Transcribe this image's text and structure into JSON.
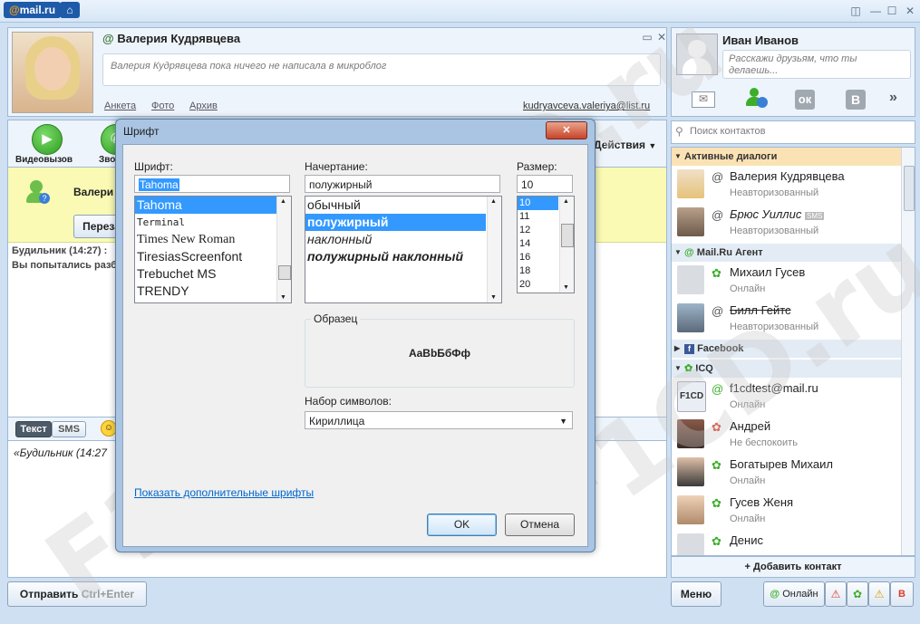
{
  "app": {
    "logo": "mail.ru",
    "logo_at": "@"
  },
  "profile": {
    "name": "Валерия Кудрявцева",
    "microblog": "Валерия Кудрявцева пока ничего не написала в микроблог",
    "links": [
      "Анкета",
      "Фото",
      "Архив"
    ],
    "email": "kudryavceva.valeriya@list.ru"
  },
  "toolbar": {
    "video_call": "Видеовызов",
    "call": "Зво",
    "actions": "Действия"
  },
  "chat": {
    "banner_name": "Валери",
    "resend": "Переза",
    "log_line1": "Будильник (14:27) :",
    "log_line2": "Вы попытались разб",
    "tab_text": "Текст",
    "tab_sms": "SMS",
    "input_text": "«Будильник (14:27"
  },
  "send": {
    "label": "Отправить",
    "shortcut": "Ctrl+Enter"
  },
  "dialog": {
    "title": "Шрифт",
    "font_label": "Шрифт:",
    "font_value": "Tahoma",
    "fonts": [
      "Tahoma",
      "Terminal",
      "Times New Roman",
      "TiresiasScreenfont",
      "Trebuchet MS",
      "TRENDY"
    ],
    "style_label": "Начертание:",
    "style_value": "полужирный",
    "styles": [
      "обычный",
      "полужирный",
      "наклонный",
      "полужирный наклонный"
    ],
    "size_label": "Размер:",
    "size_value": "10",
    "sizes": [
      "10",
      "11",
      "12",
      "14",
      "16",
      "18",
      "20"
    ],
    "sample_label": "Образец",
    "sample_text": "AaBbБбФф",
    "charset_label": "Набор символов:",
    "charset_value": "Кириллица",
    "more_fonts": "Показать дополнительные шрифты",
    "ok": "OK",
    "cancel": "Отмена",
    "close": "✕"
  },
  "user": {
    "name": "Иван Иванов",
    "status_placeholder": "Расскажи друзьям, что ты делаешь..."
  },
  "search": {
    "placeholder": "Поиск контактов"
  },
  "groups": {
    "active": "Активные диалоги",
    "agent": "Mail.Ru Агент",
    "facebook": "Facebook",
    "icq": "ICQ"
  },
  "contacts": {
    "active": [
      {
        "name": "Валерия Кудрявцева",
        "status": "Неавторизованный"
      },
      {
        "name": "Брюс Уиллис",
        "status": "Неавторизованный",
        "badge": "SMS"
      }
    ],
    "agent": [
      {
        "name": "Михаил Гусев",
        "status": "Онлайн"
      },
      {
        "name": "Билл Гейтс",
        "status": "Неавторизованный"
      }
    ],
    "icq": [
      {
        "name": "f1cdtest@mail.ru",
        "status": "Онлайн",
        "avatar_text": "F1CD"
      },
      {
        "name": "Андрей",
        "status": "Не беспокоить"
      },
      {
        "name": "Богатырев Михаил",
        "status": "Онлайн"
      },
      {
        "name": "Гусев Женя",
        "status": "Онлайн"
      },
      {
        "name": "Денис",
        "status": ""
      }
    ]
  },
  "add_contact": "Добавить контакт",
  "menu": "Меню",
  "status": {
    "label": "Онлайн"
  },
  "watermark": "F1CD.ru",
  "colors": {
    "accent": "#1e5aa8",
    "online": "#3cae2a",
    "selection": "#3399ff",
    "banner": "#fafab4"
  }
}
